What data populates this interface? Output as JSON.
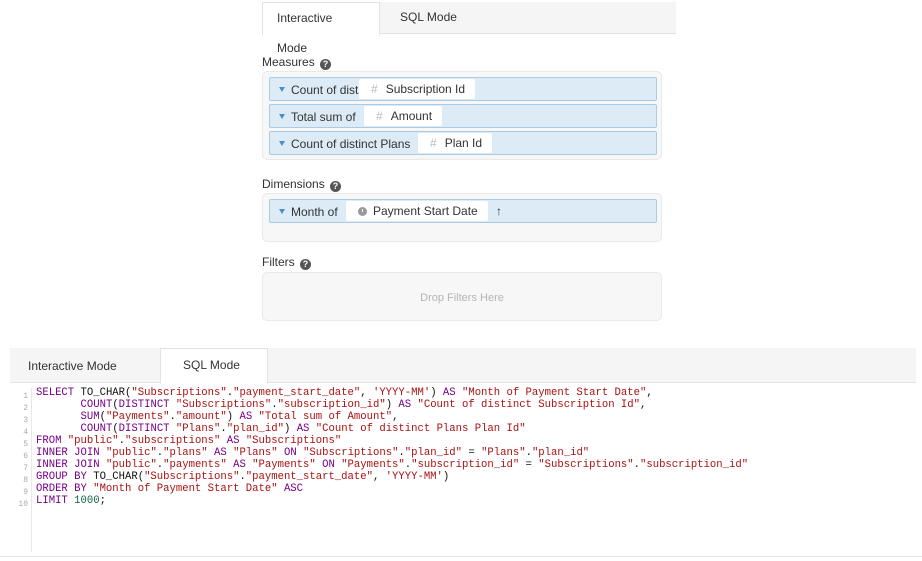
{
  "builder": {
    "tabs": [
      {
        "label": "Interactive Mode",
        "active": true
      },
      {
        "label": "SQL Mode",
        "active": false
      }
    ],
    "measures": {
      "label": "Measures",
      "items": [
        {
          "aggregation": "Count of distinct",
          "field": "Subscription Id",
          "field_icon": "hash-icon"
        },
        {
          "aggregation": "Total sum of",
          "field": "Amount",
          "field_icon": "hash-icon"
        },
        {
          "aggregation": "Count of distinct Plans",
          "field": "Plan Id",
          "field_icon": "hash-icon"
        }
      ]
    },
    "dimensions": {
      "label": "Dimensions",
      "items": [
        {
          "aggregation": "Month of",
          "field": "Payment Start Date",
          "field_icon": "clock-icon",
          "sort_glyph": "↑"
        }
      ]
    },
    "filters": {
      "label": "Filters",
      "placeholder": "Drop Filters Here"
    }
  },
  "sql_panel": {
    "tabs": [
      {
        "label": "Interactive Mode",
        "active": false
      },
      {
        "label": "SQL Mode",
        "active": true
      }
    ],
    "line_numbers": [
      "1",
      "2",
      "3",
      "4",
      "5",
      "6",
      "7",
      "8",
      "9",
      "10"
    ]
  },
  "colors": {
    "pill_bg": "#dcebf6",
    "pill_border": "#a9cbe6",
    "caret": "#4a90c8",
    "sql_keyword": "#770088",
    "sql_string": "#aa1111",
    "sql_number": "#116644"
  }
}
